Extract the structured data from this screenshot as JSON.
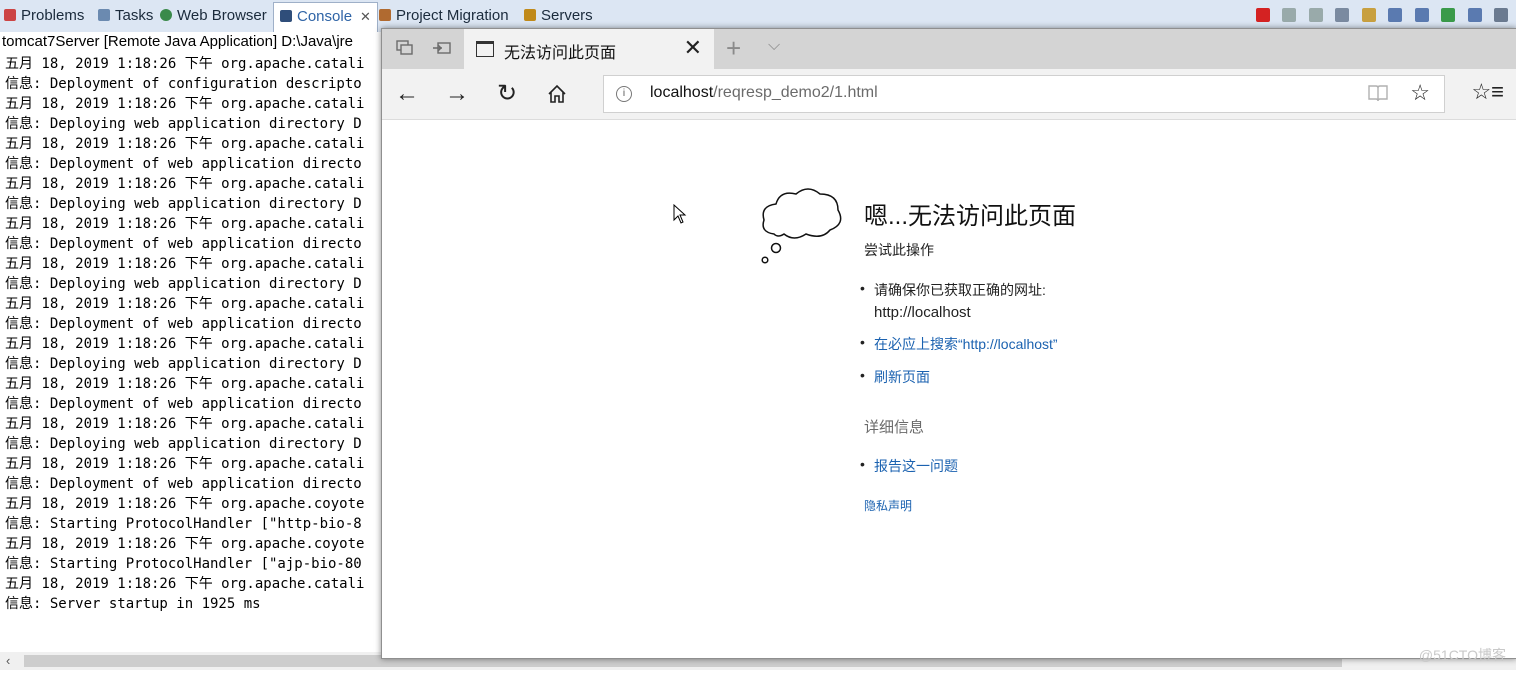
{
  "eclipse": {
    "tabs": [
      {
        "label": "Problems",
        "icon": "problems-icon"
      },
      {
        "label": "Tasks",
        "icon": "tasks-icon"
      },
      {
        "label": "Web Browser",
        "icon": "globe-icon"
      },
      {
        "label": "Console",
        "icon": "console-icon",
        "active": true
      },
      {
        "label": "Project Migration",
        "icon": "migration-icon"
      },
      {
        "label": "Servers",
        "icon": "servers-icon"
      }
    ],
    "console_close": "✕",
    "console_header": "tomcat7Server [Remote Java Application] D:\\Java\\jre",
    "console_lines": [
      "五月 18, 2019 1:18:26 下午 org.apache.catali",
      "信息: Deployment of configuration descripto",
      "五月 18, 2019 1:18:26 下午 org.apache.catali",
      "信息: Deploying web application directory D",
      "五月 18, 2019 1:18:26 下午 org.apache.catali",
      "信息: Deployment of web application directo",
      "五月 18, 2019 1:18:26 下午 org.apache.catali",
      "信息: Deploying web application directory D",
      "五月 18, 2019 1:18:26 下午 org.apache.catali",
      "信息: Deployment of web application directo",
      "五月 18, 2019 1:18:26 下午 org.apache.catali",
      "信息: Deploying web application directory D",
      "五月 18, 2019 1:18:26 下午 org.apache.catali",
      "信息: Deployment of web application directo",
      "五月 18, 2019 1:18:26 下午 org.apache.catali",
      "信息: Deploying web application directory D",
      "五月 18, 2019 1:18:26 下午 org.apache.catali",
      "信息: Deployment of web application directo",
      "五月 18, 2019 1:18:26 下午 org.apache.catali",
      "信息: Deploying web application directory D",
      "五月 18, 2019 1:18:26 下午 org.apache.catali",
      "信息: Deployment of web application directo",
      "五月 18, 2019 1:18:26 下午 org.apache.coyote",
      "信息: Starting ProtocolHandler [\"http-bio-8",
      "五月 18, 2019 1:18:26 下午 org.apache.coyote",
      "信息: Starting ProtocolHandler [\"ajp-bio-80",
      "五月 18, 2019 1:18:26 下午 org.apache.catali",
      "信息: Server startup in 1925 ms"
    ],
    "scroll_left_arrow": "‹"
  },
  "browser": {
    "tab_title": "无法访问此页面",
    "tab_close": "✕",
    "new_tab": "+",
    "tab_menu": "⌵",
    "url_host": "localhost",
    "url_path": "/reqresp_demo2/1.html",
    "nav": {
      "back": "←",
      "forward": "→",
      "refresh": "↻",
      "home": "⌂",
      "favorite": "☆",
      "favorites_hub": "☆≡"
    },
    "error": {
      "title": "嗯...无法访问此页面",
      "subtitle": "尝试此操作",
      "bullet1_line1": "请确保你已获取正确的网址:",
      "bullet1_line2": "http://localhost",
      "bullet2_link": "在必应上搜索“http://localhost”",
      "bullet3_link": "刷新页面",
      "details_heading": "详细信息",
      "bullet4_link": "报告这一问题",
      "privacy_link": "隐私声明"
    }
  },
  "watermark": "@51CTO博客",
  "colors": {
    "link": "#1b62b0",
    "eclipse_tab_active": "#2f64a6",
    "tabstrip": "#d4d4d4"
  }
}
